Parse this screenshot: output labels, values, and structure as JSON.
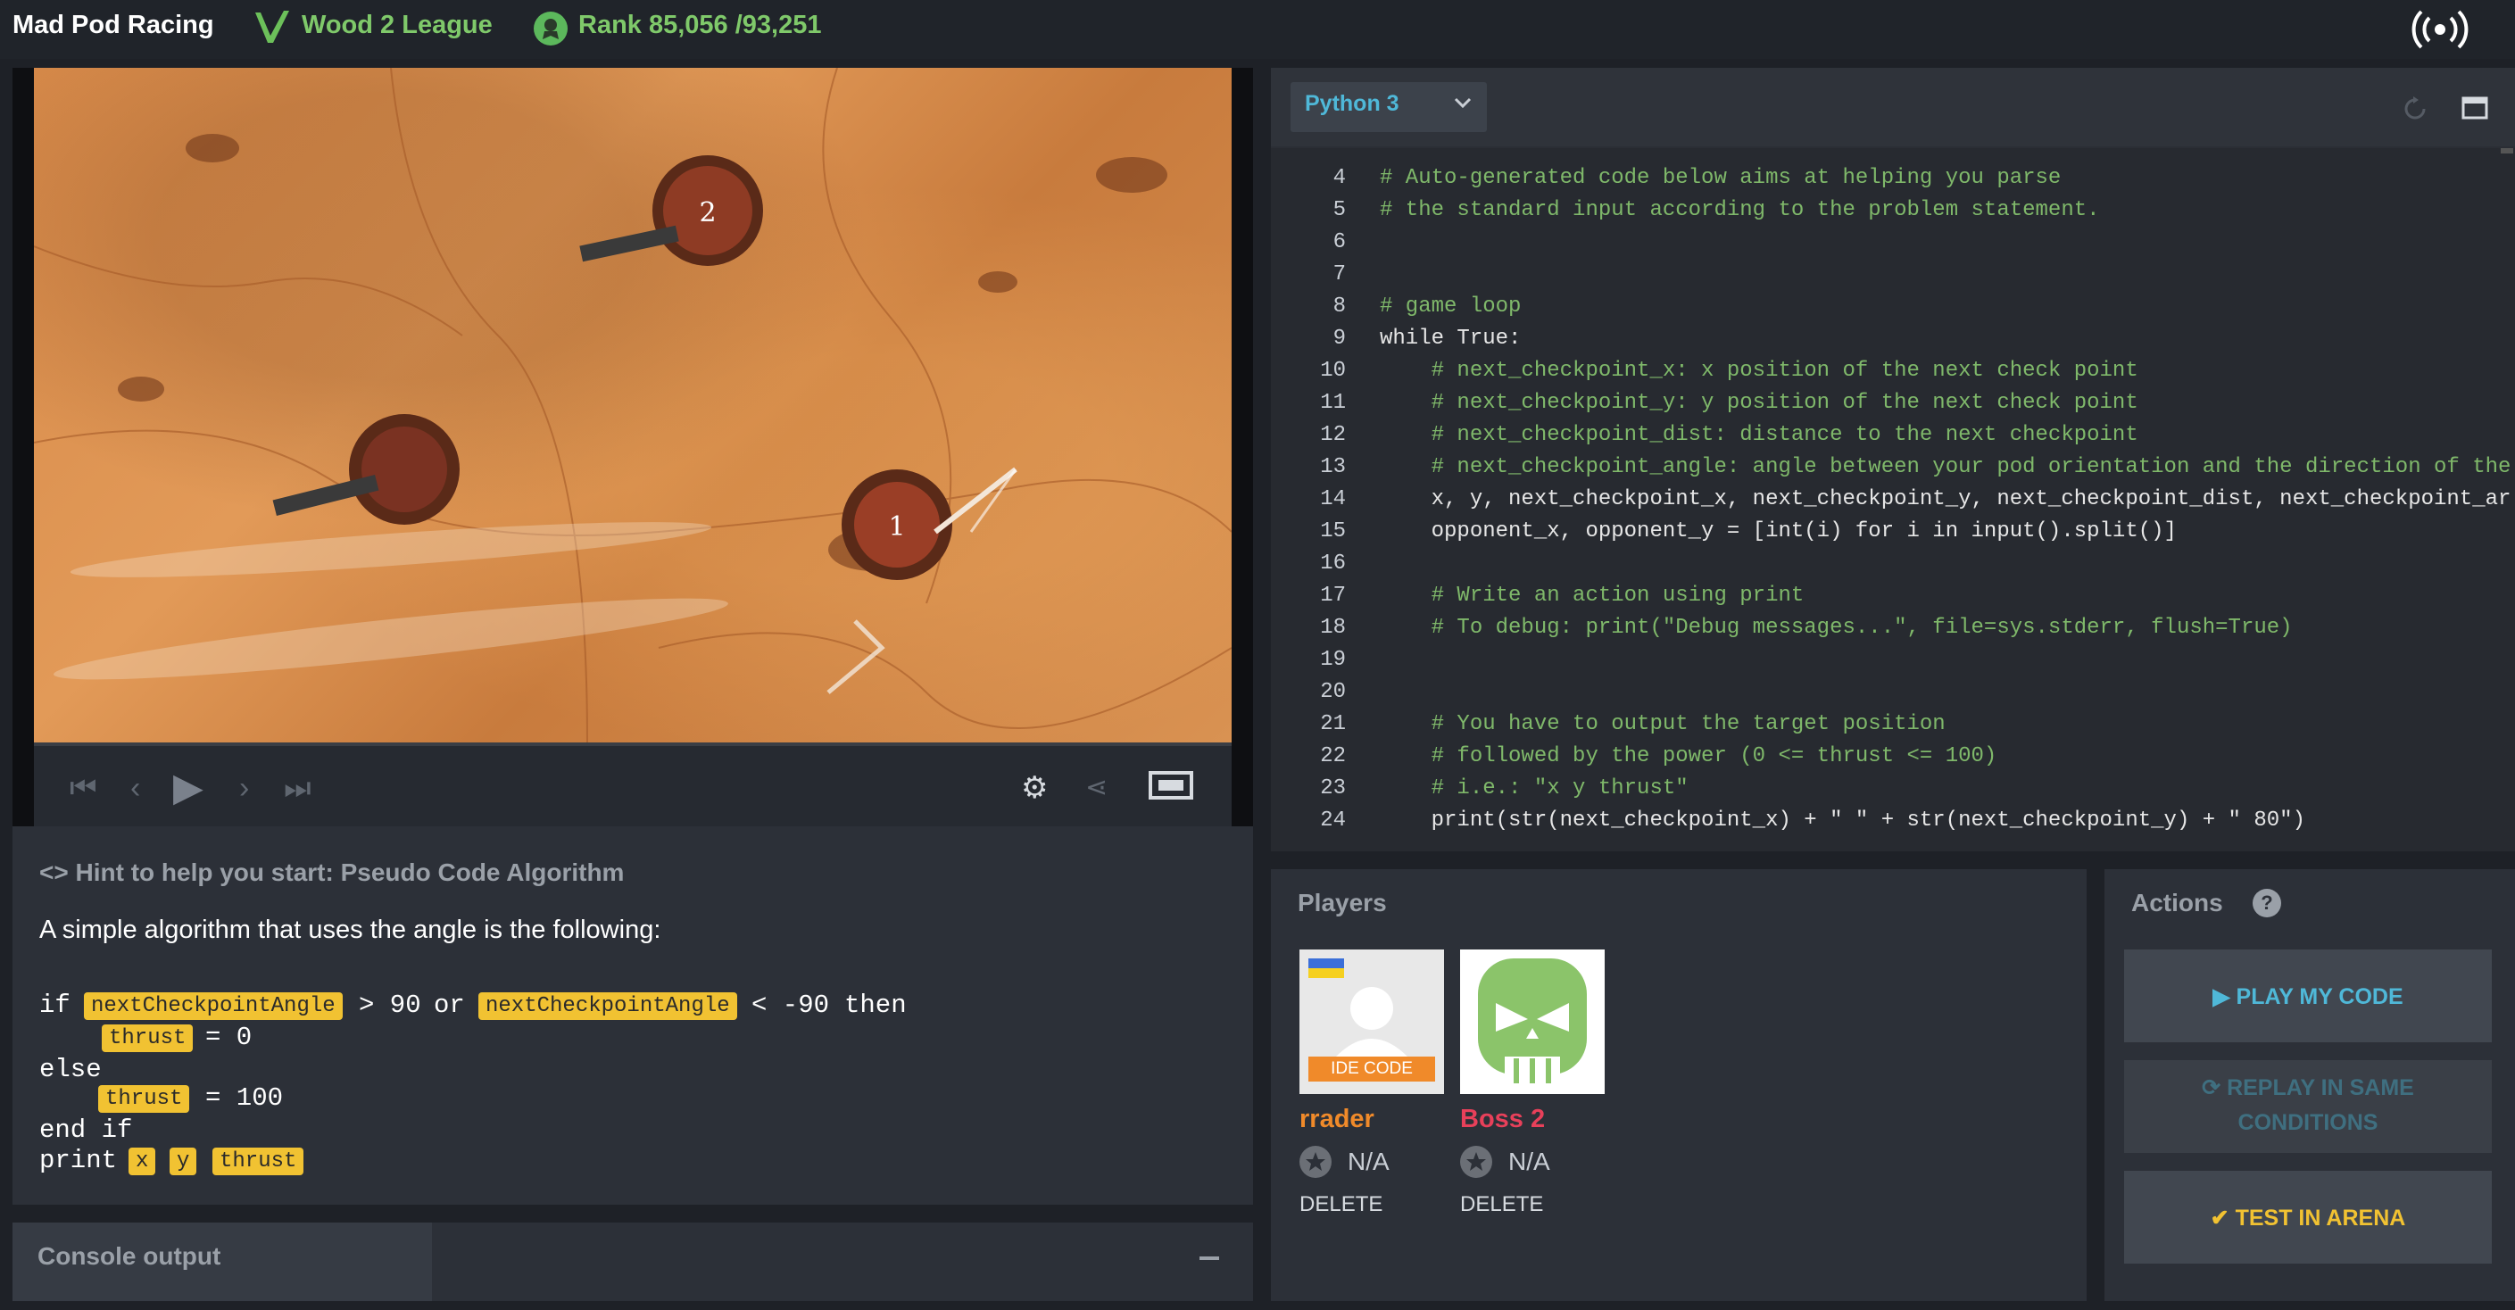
{
  "topbar": {
    "title": "Mad Pod Racing",
    "league": "Wood 2 League",
    "rank": "Rank 85,056 /93,251",
    "league_icon": "wood-league-icon",
    "rank_icon": "rank-badge-icon",
    "broadcast_icon": "broadcast-icon"
  },
  "game": {
    "checkpoints": [
      "2",
      "1"
    ]
  },
  "hint": {
    "title": "Hint to help you start: Pseudo Code Algorithm",
    "description": "A simple algorithm that uses the angle is the following:",
    "code": {
      "if": "if",
      "angle_var": "nextCheckpointAngle",
      "gt90": "> 90",
      "or": "or",
      "lt": "< -90",
      "then": "then",
      "thrust_var": "thrust",
      "eq0": "= 0",
      "else": "else",
      "eq100": "= 100",
      "endif": "end if",
      "print": "print",
      "x": "x",
      "y": "y"
    }
  },
  "console": {
    "title": "Console output"
  },
  "editor": {
    "language": "Python 3",
    "lines": [
      {
        "n": "4",
        "text": "# Auto-generated code below aims at helping you parse"
      },
      {
        "n": "5",
        "text": "# the standard input according to the problem statement."
      },
      {
        "n": "6",
        "text": ""
      },
      {
        "n": "7",
        "text": ""
      },
      {
        "n": "8",
        "text": "# game loop"
      },
      {
        "n": "9",
        "text": "while True:"
      },
      {
        "n": "10",
        "text": "    # next_checkpoint_x: x position of the next check point"
      },
      {
        "n": "11",
        "text": "    # next_checkpoint_y: y position of the next check point"
      },
      {
        "n": "12",
        "text": "    # next_checkpoint_dist: distance to the next checkpoint"
      },
      {
        "n": "13",
        "text": "    # next_checkpoint_angle: angle between your pod orientation and the direction of the"
      },
      {
        "n": "14",
        "text": "    x, y, next_checkpoint_x, next_checkpoint_y, next_checkpoint_dist, next_checkpoint_ar"
      },
      {
        "n": "15",
        "text": "    opponent_x, opponent_y = [int(i) for i in input().split()]"
      },
      {
        "n": "16",
        "text": ""
      },
      {
        "n": "17",
        "text": "    # Write an action using print"
      },
      {
        "n": "18",
        "text": "    # To debug: print(\"Debug messages...\", file=sys.stderr, flush=True)"
      },
      {
        "n": "19",
        "text": ""
      },
      {
        "n": "20",
        "text": ""
      },
      {
        "n": "21",
        "text": "    # You have to output the target position"
      },
      {
        "n": "22",
        "text": "    # followed by the power (0 <= thrust <= 100)"
      },
      {
        "n": "23",
        "text": "    # i.e.: \"x y thrust\""
      },
      {
        "n": "24",
        "text": "    print(str(next_checkpoint_x) + \" \" + str(next_checkpoint_y) + \" 80\")"
      }
    ]
  },
  "players": {
    "title": "Players",
    "list": [
      {
        "name": "rrader",
        "score": "N/A",
        "delete": "DELETE",
        "badge": "IDE CODE",
        "color": "#f08a2a"
      },
      {
        "name": "Boss 2",
        "score": "N/A",
        "delete": "DELETE",
        "color": "#e8405a"
      }
    ]
  },
  "actions": {
    "title": "Actions",
    "help": "?",
    "play": "PLAY MY CODE",
    "replay_line1": "REPLAY IN SAME",
    "replay_line2": "CONDITIONS",
    "arena": "TEST IN ARENA"
  },
  "colors": {
    "accent_green": "#7fc96a",
    "accent_blue": "#4fb8d8",
    "highlight_yellow": "#f1c232"
  }
}
